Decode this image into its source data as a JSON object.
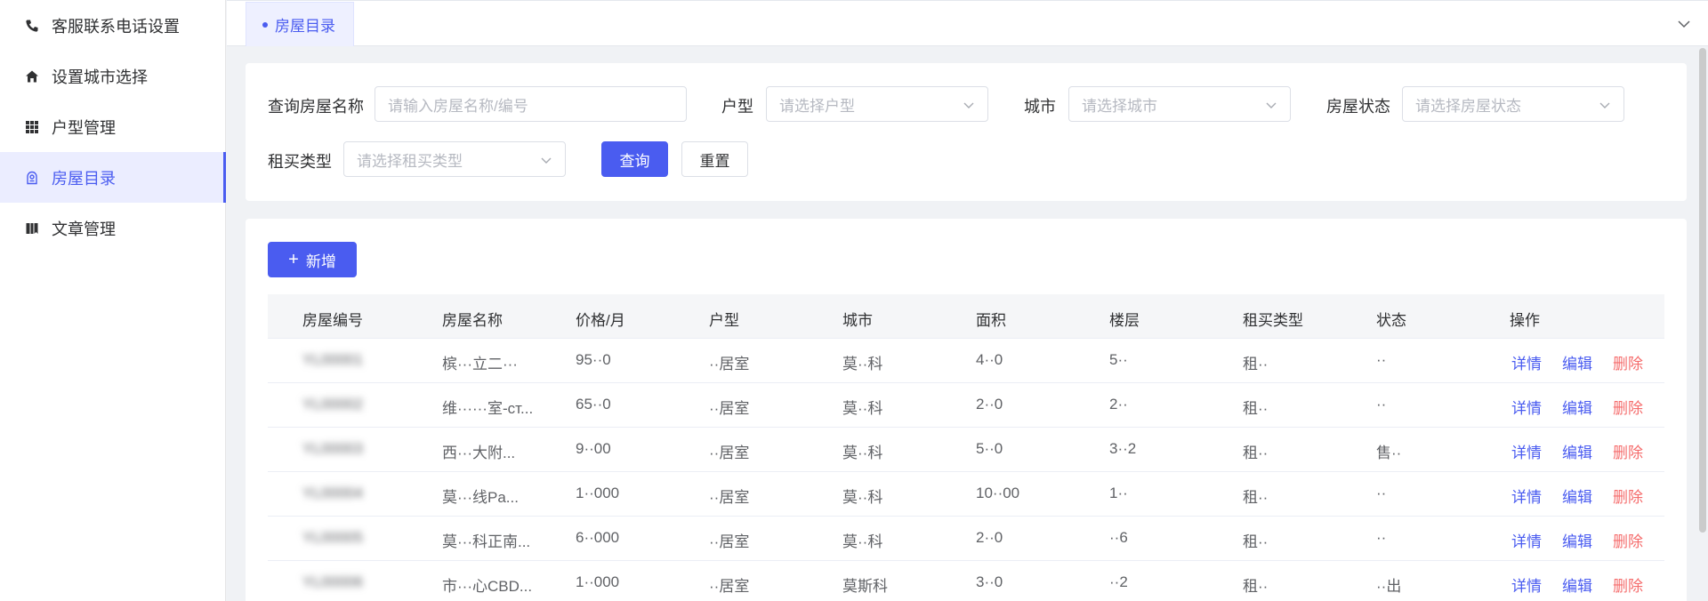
{
  "sidebar": {
    "items": [
      {
        "label": "客服联系电话设置",
        "icon": "phone-icon"
      },
      {
        "label": "设置城市选择",
        "icon": "home-icon"
      },
      {
        "label": "户型管理",
        "icon": "grid-icon"
      },
      {
        "label": "房屋目录",
        "icon": "house-tag-icon",
        "active": true
      },
      {
        "label": "文章管理",
        "icon": "book-icon"
      }
    ]
  },
  "tabs": {
    "active_label": "房屋目录"
  },
  "search": {
    "name_label": "查询房屋名称",
    "name_placeholder": "请输入房屋名称/编号",
    "type_label": "户型",
    "type_placeholder": "请选择户型",
    "city_label": "城市",
    "city_placeholder": "请选择城市",
    "status_label": "房屋状态",
    "status_placeholder": "请选择房屋状态",
    "rent_label": "租买类型",
    "rent_placeholder": "请选择租买类型",
    "query_label": "查询",
    "reset_label": "重置"
  },
  "toolbar": {
    "add_label": "新增"
  },
  "table": {
    "headers": [
      "房屋编号",
      "房屋名称",
      "价格/月",
      "户型",
      "城市",
      "面积",
      "楼层",
      "租买类型",
      "状态",
      "操作"
    ],
    "actions": {
      "detail": "详情",
      "edit": "编辑",
      "delete": "删除"
    },
    "rows": [
      {
        "id": "YL00001",
        "name": "槟···立二···",
        "price": "95··0",
        "type": "··居室",
        "city": "莫··科",
        "area": "4··0",
        "floor": "5··",
        "rent": "租··",
        "status": "··"
      },
      {
        "id": "YL00002",
        "name": "维······室-ст...",
        "price": "65··0",
        "type": "··居室",
        "city": "莫··科",
        "area": "2··0",
        "floor": "2··",
        "rent": "租··",
        "status": "··"
      },
      {
        "id": "YL00003",
        "name": "西···大附...",
        "price": "9··00",
        "type": "··居室",
        "city": "莫··科",
        "area": "5··0",
        "floor": "3··2",
        "rent": "租··",
        "status": "售··"
      },
      {
        "id": "YL00004",
        "name": "莫···线Pa...",
        "price": "1··000",
        "type": "··居室",
        "city": "莫··科",
        "area": "10··00",
        "floor": "1··",
        "rent": "租··",
        "status": "··"
      },
      {
        "id": "YL00005",
        "name": "莫···科正南...",
        "price": "6··000",
        "type": "··居室",
        "city": "莫··科",
        "area": "2··0",
        "floor": "··6",
        "rent": "租··",
        "status": "··"
      },
      {
        "id": "YL00006",
        "name": "市···心CBD...",
        "price": "1··000",
        "type": "··居室",
        "city": "莫斯科",
        "area": "3··0",
        "floor": "··2",
        "rent": "租··",
        "status": "··出"
      }
    ]
  },
  "colors": {
    "accent": "#4a5cf0",
    "danger": "#f56c6c",
    "active_bg": "#ebedff"
  }
}
